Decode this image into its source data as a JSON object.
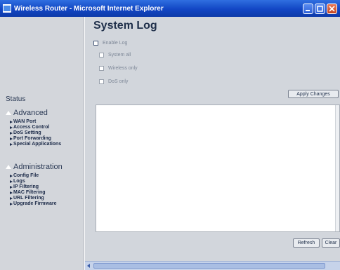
{
  "window": {
    "title": "Wireless Router - Microsoft Internet Explorer"
  },
  "sidebar": {
    "status_label": "Status",
    "groups": [
      {
        "title": "Advanced",
        "items": [
          "WAN Port",
          "Access Control",
          "DoS Setting",
          "Port Forwarding",
          "Special Applications"
        ]
      },
      {
        "title": "Administration",
        "items": [
          "Config File",
          "Logs",
          "IP Filtering",
          "MAC Filtering",
          "URL Filtering",
          "Upgrade Firmware"
        ]
      }
    ]
  },
  "main": {
    "title": "System Log",
    "enable_log": "Enable Log",
    "options": [
      "System all",
      "Wireless only",
      "DoS only"
    ],
    "apply_label": "Apply Changes",
    "log_text": "",
    "refresh_label": "Refresh",
    "clear_label": "Clear"
  },
  "icons": {
    "app": "browser-icon",
    "minimize": "minimize-icon",
    "maximize": "maximize-icon",
    "close": "close-icon",
    "menu_item": "arrow-icon"
  },
  "colors": {
    "titlebar": "#1246c4",
    "sidebar_bg": "#d3d6db",
    "main_bg": "#d2d6dc",
    "heading": "#1f2f4a"
  }
}
